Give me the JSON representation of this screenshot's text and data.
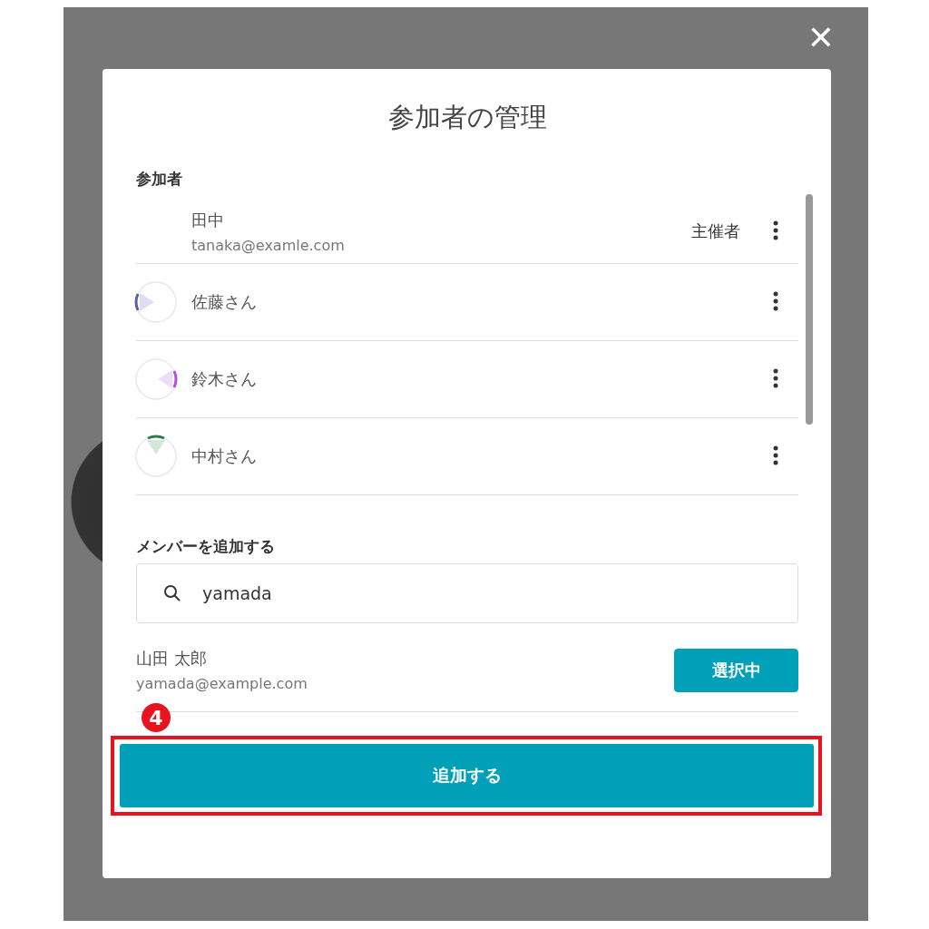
{
  "dialog": {
    "title": "参加者の管理",
    "close": "✕"
  },
  "participants_section": {
    "heading": "参加者"
  },
  "participants": [
    {
      "name": "田中",
      "email": "tanaka@examle.com",
      "role": "主催者",
      "has_avatar": false
    },
    {
      "name": "佐藤さん",
      "has_avatar": true,
      "color": "#5c5ca8"
    },
    {
      "name": "鈴木さん",
      "has_avatar": true,
      "color": "#b04fe0"
    },
    {
      "name": "中村さん",
      "has_avatar": true,
      "color": "#2e7d4a"
    }
  ],
  "add_member": {
    "heading": "メンバーを追加する",
    "search_value": "yamada",
    "results": [
      {
        "name": "山田 太郎",
        "email": "yamada@example.com",
        "button": "選択中",
        "selected": true
      }
    ],
    "submit": "追加する"
  },
  "annotation": {
    "label": "4"
  }
}
